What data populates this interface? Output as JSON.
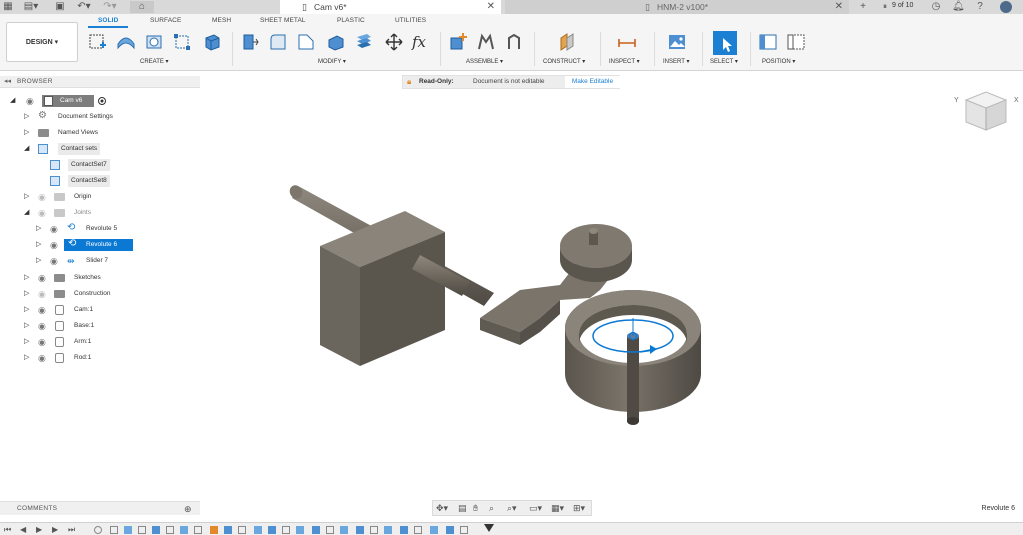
{
  "titlebar": {
    "active_tab": "Cam v6*",
    "inactive_tab": "HNM-2 v100*",
    "job_status": "9 of 10"
  },
  "toolbar": {
    "design_label": "DESIGN ▾",
    "workspace_tabs": [
      "SOLID",
      "SURFACE",
      "MESH",
      "SHEET METAL",
      "PLASTIC",
      "UTILITIES"
    ],
    "groups": [
      "CREATE ▾",
      "MODIFY ▾",
      "ASSEMBLE ▾",
      "CONSTRUCT ▾",
      "INSPECT ▾",
      "INSERT ▾",
      "SELECT ▾",
      "POSITION ▾"
    ]
  },
  "browser": {
    "title": "BROWSER",
    "root": "Cam v6",
    "items": [
      {
        "label": "Document Settings"
      },
      {
        "label": "Named Views"
      },
      {
        "label": "Contact sets"
      },
      {
        "label": "ContactSet7"
      },
      {
        "label": "ContactSet8"
      },
      {
        "label": "Origin"
      },
      {
        "label": "Joints"
      },
      {
        "label": "Revolute 5"
      },
      {
        "label": "Revolute 6"
      },
      {
        "label": "Slider 7"
      },
      {
        "label": "Sketches"
      },
      {
        "label": "Construction"
      },
      {
        "label": "Cam:1"
      },
      {
        "label": "Base:1"
      },
      {
        "label": "Arm:1"
      },
      {
        "label": "Rod:1"
      }
    ]
  },
  "banner": {
    "title": "Read-Only:",
    "description": "Document is not editable",
    "action": "Make Editable"
  },
  "viewcube": {
    "left_label": "Y",
    "right_label": "X"
  },
  "comments": {
    "title": "COMMENTS"
  },
  "status": {
    "selection": "Revolute 6"
  },
  "colors": {
    "accent": "#1b7fd3",
    "model": "#6e685f",
    "selection": "#0b78d4"
  }
}
